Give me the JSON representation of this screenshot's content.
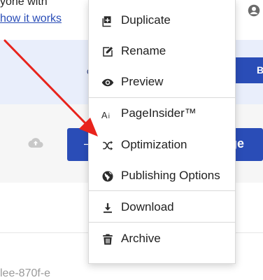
{
  "background": {
    "header_text_fragment": "yone with",
    "link_text_fragment": " how it works",
    "band_text_fragment": "c",
    "band_button_fragment": "B",
    "blue_button_left_fragment": "–",
    "blue_button_right_fragment": "ge",
    "id_fragment": "lee-870f-e"
  },
  "menu": {
    "items": [
      {
        "label": "Duplicate",
        "icon": "duplicate-icon"
      },
      {
        "label": "Rename",
        "icon": "rename-icon"
      },
      {
        "label": "Preview",
        "icon": "eye-icon"
      },
      {
        "label": "PageInsider™",
        "icon": "ai-text-icon"
      },
      {
        "label": "Optimization",
        "icon": "shuffle-icon"
      },
      {
        "label": "Publishing Options",
        "icon": "globe-icon"
      },
      {
        "label": "Download",
        "icon": "download-icon"
      },
      {
        "label": "Archive",
        "icon": "trash-icon"
      }
    ]
  },
  "colors": {
    "accent": "#2a4db7",
    "arrow": "#e8231c"
  }
}
